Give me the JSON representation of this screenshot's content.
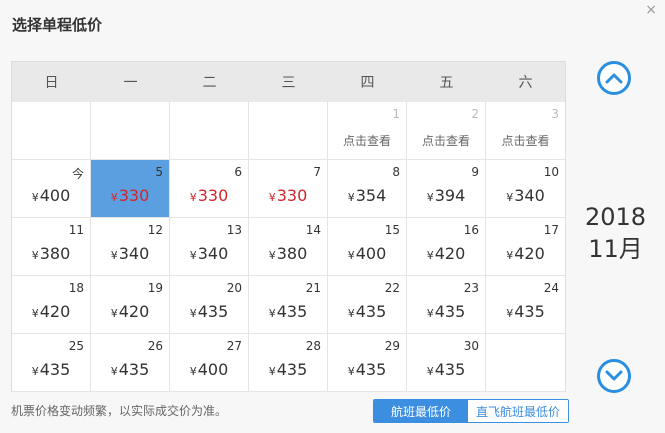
{
  "dialog": {
    "title": "选择单程低价",
    "close": "×"
  },
  "weekdays": [
    "日",
    "一",
    "二",
    "三",
    "四",
    "五",
    "六"
  ],
  "calendar": {
    "currency": "¥",
    "check_label": "点击查看",
    "cells": [
      {
        "day": "",
        "price": "",
        "type": "empty"
      },
      {
        "day": "",
        "price": "",
        "type": "empty"
      },
      {
        "day": "",
        "price": "",
        "type": "empty"
      },
      {
        "day": "",
        "price": "",
        "type": "empty"
      },
      {
        "day": "1",
        "price": "",
        "type": "past"
      },
      {
        "day": "2",
        "price": "",
        "type": "past"
      },
      {
        "day": "3",
        "price": "",
        "type": "past"
      },
      {
        "day": "今",
        "price": "400",
        "type": "normal"
      },
      {
        "day": "5",
        "price": "330",
        "type": "selected"
      },
      {
        "day": "6",
        "price": "330",
        "type": "low"
      },
      {
        "day": "7",
        "price": "330",
        "type": "low"
      },
      {
        "day": "8",
        "price": "354",
        "type": "normal"
      },
      {
        "day": "9",
        "price": "394",
        "type": "normal"
      },
      {
        "day": "10",
        "price": "340",
        "type": "normal"
      },
      {
        "day": "11",
        "price": "380",
        "type": "normal"
      },
      {
        "day": "12",
        "price": "340",
        "type": "normal"
      },
      {
        "day": "13",
        "price": "340",
        "type": "normal"
      },
      {
        "day": "14",
        "price": "380",
        "type": "normal"
      },
      {
        "day": "15",
        "price": "400",
        "type": "normal"
      },
      {
        "day": "16",
        "price": "420",
        "type": "normal"
      },
      {
        "day": "17",
        "price": "420",
        "type": "normal"
      },
      {
        "day": "18",
        "price": "420",
        "type": "normal"
      },
      {
        "day": "19",
        "price": "420",
        "type": "normal"
      },
      {
        "day": "20",
        "price": "435",
        "type": "normal"
      },
      {
        "day": "21",
        "price": "435",
        "type": "normal"
      },
      {
        "day": "22",
        "price": "435",
        "type": "normal"
      },
      {
        "day": "23",
        "price": "435",
        "type": "normal"
      },
      {
        "day": "24",
        "price": "435",
        "type": "normal"
      },
      {
        "day": "25",
        "price": "435",
        "type": "normal"
      },
      {
        "day": "26",
        "price": "435",
        "type": "normal"
      },
      {
        "day": "27",
        "price": "400",
        "type": "normal"
      },
      {
        "day": "28",
        "price": "435",
        "type": "normal"
      },
      {
        "day": "29",
        "price": "435",
        "type": "normal"
      },
      {
        "day": "30",
        "price": "435",
        "type": "normal"
      },
      {
        "day": "",
        "price": "",
        "type": "empty"
      }
    ]
  },
  "side": {
    "year": "2018",
    "month": "11月",
    "up_icon": "chevron-up-icon",
    "down_icon": "chevron-down-icon"
  },
  "footer": {
    "note": "机票价格变动频繁，以实际成交价为准。",
    "toggle_active": "航班最低价",
    "toggle_inactive": "直飞航班最低价"
  },
  "colors": {
    "accent": "#3b8ee0",
    "selected_bg": "#5b9fe0",
    "low_price": "#d0262b"
  }
}
